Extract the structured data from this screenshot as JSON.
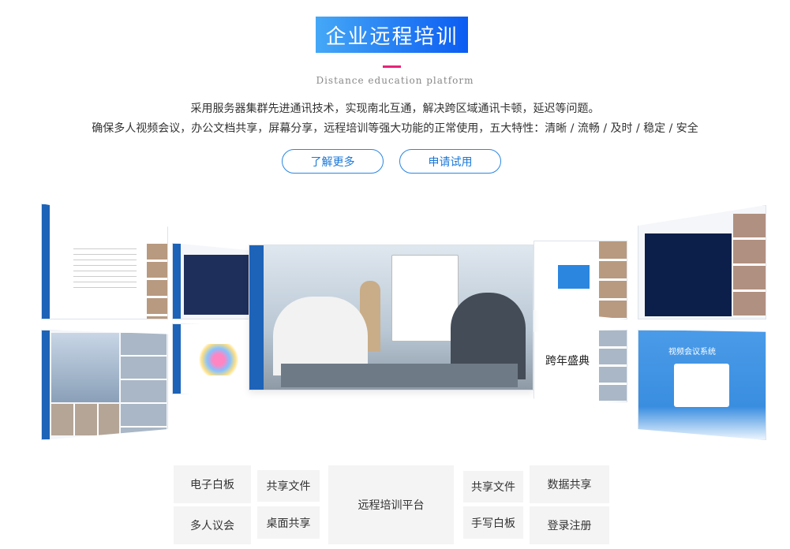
{
  "header": {
    "title": "企业远程培训",
    "subtitle": "Distance education platform",
    "lines": [
      "采用服务器集群先进通讯技术，实现南北互通，解决跨区域通讯卡顿，延迟等问题。",
      "确保多人视频会议，办公文档共享，屏幕分享，远程培训等强大功能的正常使用，五大特性：清晰 / 流畅 / 及时 / 稳定 / 安全"
    ]
  },
  "buttons": {
    "learn_more": "了解更多",
    "apply_trial": "申请试用"
  },
  "colors": {
    "accent": "#1a78d8",
    "title_gradient_start": "#45a8f6",
    "title_gradient_end": "#0b5cf2",
    "divider": "#e8237a"
  },
  "gallery": {
    "panel_login_title": "视频会议系统",
    "panel_event_text": "跨年盛典"
  },
  "features": {
    "left": [
      "电子白板",
      "共享文件",
      "多人议会",
      "桌面共享"
    ],
    "center": "远程培训平台",
    "right": [
      "共享文件",
      "数据共享",
      "手写白板",
      "登录注册"
    ]
  }
}
